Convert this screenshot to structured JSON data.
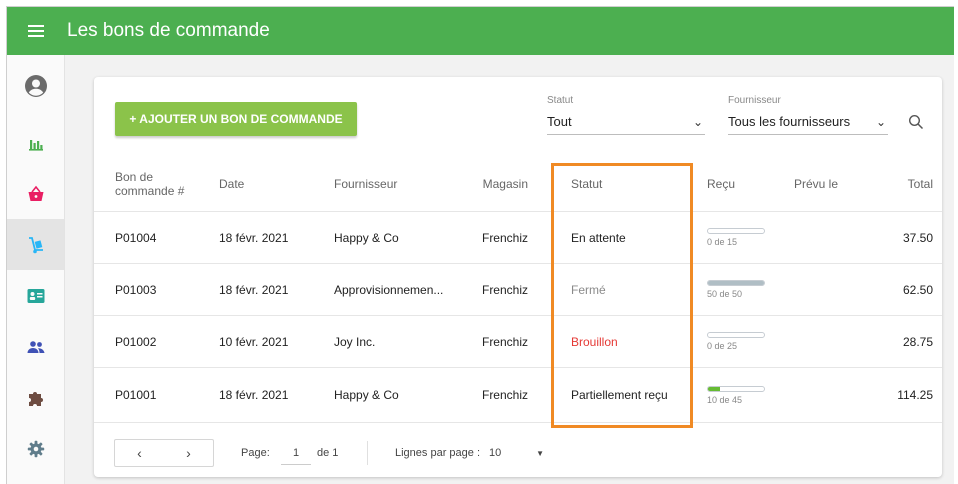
{
  "header": {
    "title": "Les bons de commande"
  },
  "sidebar": {
    "items": [
      {
        "icon": "account-circle-icon",
        "active": false
      },
      {
        "icon": "chart-bar-icon",
        "active": false
      },
      {
        "icon": "basket-icon",
        "active": false
      },
      {
        "icon": "hand-truck-icon",
        "active": true
      },
      {
        "icon": "contact-card-icon",
        "active": false
      },
      {
        "icon": "people-icon",
        "active": false
      },
      {
        "icon": "puzzle-icon",
        "active": false
      },
      {
        "icon": "gear-icon",
        "active": false
      }
    ]
  },
  "toolbar": {
    "add_label": "+ AJOUTER UN BON DE COMMANDE",
    "statut_label": "Statut",
    "statut_value": "Tout",
    "fournisseur_label": "Fournisseur",
    "fournisseur_value": "Tous les fournisseurs"
  },
  "table": {
    "headers": {
      "bon": "Bon de commande #",
      "date": "Date",
      "fournisseur": "Fournisseur",
      "magasin": "Magasin",
      "statut": "Statut",
      "recu": "Reçu",
      "prevu": "Prévu le",
      "total": "Total"
    },
    "rows": [
      {
        "bon": "P01004",
        "date": "18 févr. 2021",
        "fournisseur": "Happy & Co",
        "magasin": "Frenchiz",
        "statut": "En attente",
        "recu": "0 de 15",
        "recu_fraction": 0,
        "prevu": "",
        "total": "37.50"
      },
      {
        "bon": "P01003",
        "date": "18 févr. 2021",
        "fournisseur": "Approvisionnemen...",
        "magasin": "Frenchiz",
        "statut": "Fermé",
        "recu": "50 de 50",
        "recu_fraction": 1,
        "prevu": "",
        "total": "62.50"
      },
      {
        "bon": "P01002",
        "date": "10 févr. 2021",
        "fournisseur": "Joy Inc.",
        "magasin": "Frenchiz",
        "statut": "Brouillon",
        "recu": "0 de 25",
        "recu_fraction": 0,
        "prevu": "",
        "total": "28.75"
      },
      {
        "bon": "P01001",
        "date": "18 févr. 2021",
        "fournisseur": "Happy & Co",
        "magasin": "Frenchiz",
        "statut": "Partiellement reçu",
        "recu": "10 de 45",
        "recu_fraction": 0.222,
        "prevu": "",
        "total": "114.25"
      }
    ]
  },
  "footer": {
    "page_label": "Page:",
    "page_value": "1",
    "page_of": "de 1",
    "rows_label": "Lignes par page :",
    "rows_value": "10"
  },
  "colors": {
    "header_bg": "#4caf50",
    "add_button_bg": "#8bc34a",
    "draft_status": "#e53935",
    "highlight_border": "#f08a24",
    "bar_closed": "#b0bec5",
    "bar_partial": "#66bb33"
  }
}
